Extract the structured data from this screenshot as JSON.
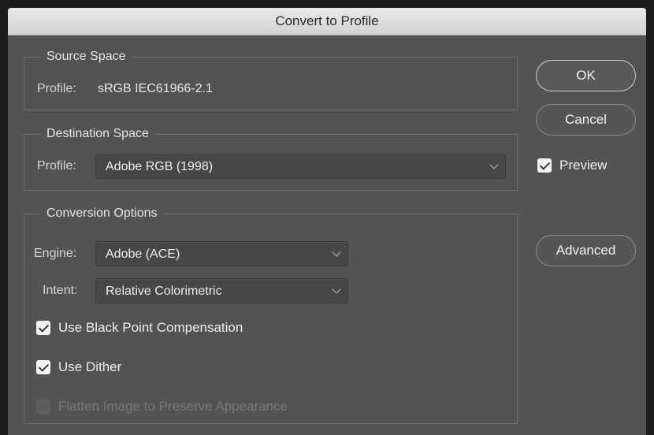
{
  "window": {
    "title": "Convert to Profile"
  },
  "source_space": {
    "legend": "Source Space",
    "profile_label": "Profile:",
    "profile_value": "sRGB IEC61966-2.1"
  },
  "destination_space": {
    "legend": "Destination Space",
    "profile_label": "Profile:",
    "profile_selected": "Adobe RGB (1998)"
  },
  "conversion_options": {
    "legend": "Conversion Options",
    "engine_label": "Engine:",
    "engine_selected": "Adobe (ACE)",
    "intent_label": "Intent:",
    "intent_selected": "Relative Colorimetric",
    "checkboxes": [
      {
        "label": "Use Black Point Compensation",
        "checked": true,
        "enabled": true
      },
      {
        "label": "Use Dither",
        "checked": true,
        "enabled": true
      },
      {
        "label": "Flatten Image to Preserve Appearance",
        "checked": false,
        "enabled": false
      }
    ]
  },
  "buttons": {
    "ok": "OK",
    "cancel": "Cancel",
    "advanced": "Advanced"
  },
  "preview": {
    "label": "Preview",
    "checked": true
  },
  "icons": {
    "dropdown": "chevron-down-icon",
    "check": "checkmark-icon"
  },
  "colors": {
    "dialog_bg": "#535353",
    "titlebar_bg": "#d9d9d9",
    "outer_bg": "#1d1d1d"
  }
}
